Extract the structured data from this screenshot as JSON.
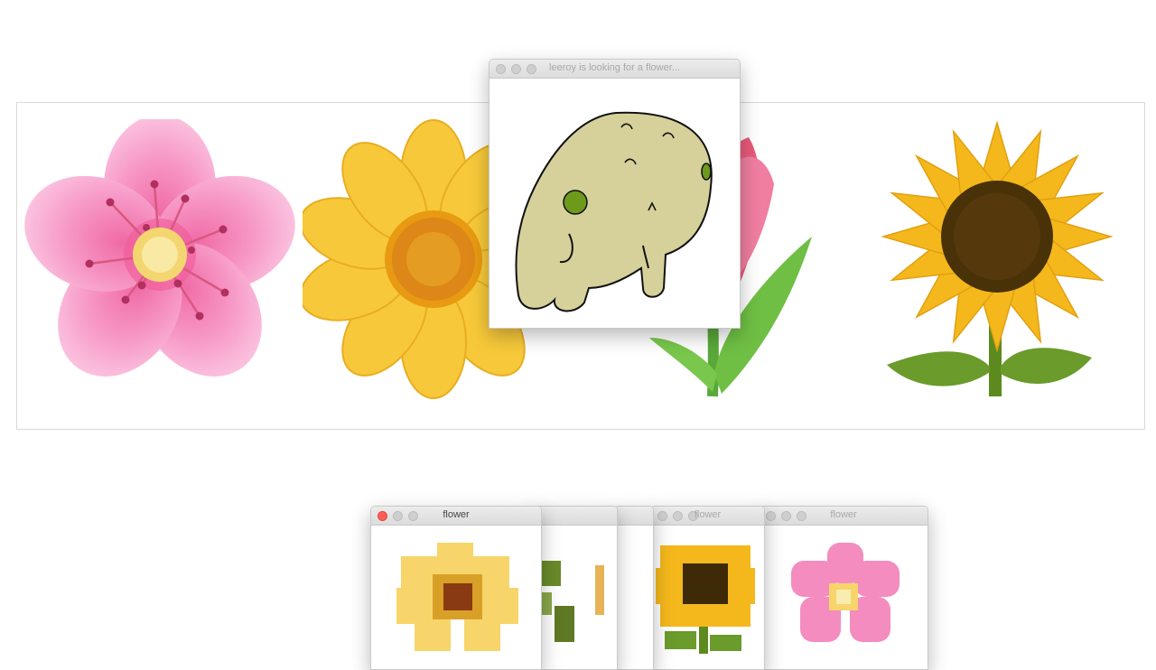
{
  "main_window": {
    "title": "leeroy is looking for a flower..."
  },
  "flower_windows": [
    {
      "title": "flower",
      "icon": "yellow-daisy-pixel"
    },
    {
      "title": "",
      "icon": "tulip-pixel"
    },
    {
      "title": "",
      "icon": "tulip-pixel"
    },
    {
      "title": "flower",
      "icon": "sunflower-pixel"
    },
    {
      "title": "flower",
      "icon": "pink-blossom-pixel"
    }
  ],
  "strip": {
    "flowers": [
      "pink-blossom",
      "yellow-daisy",
      "tulip",
      "sunflower"
    ]
  },
  "colors": {
    "creature_body": "#d6d19a",
    "creature_spot": "#6e9a1c",
    "pink_petal": "#f48cc0",
    "yellow_petal": "#f7c93a",
    "sunflower_center": "#4a3208",
    "leaf_green": "#6a9b2b"
  }
}
